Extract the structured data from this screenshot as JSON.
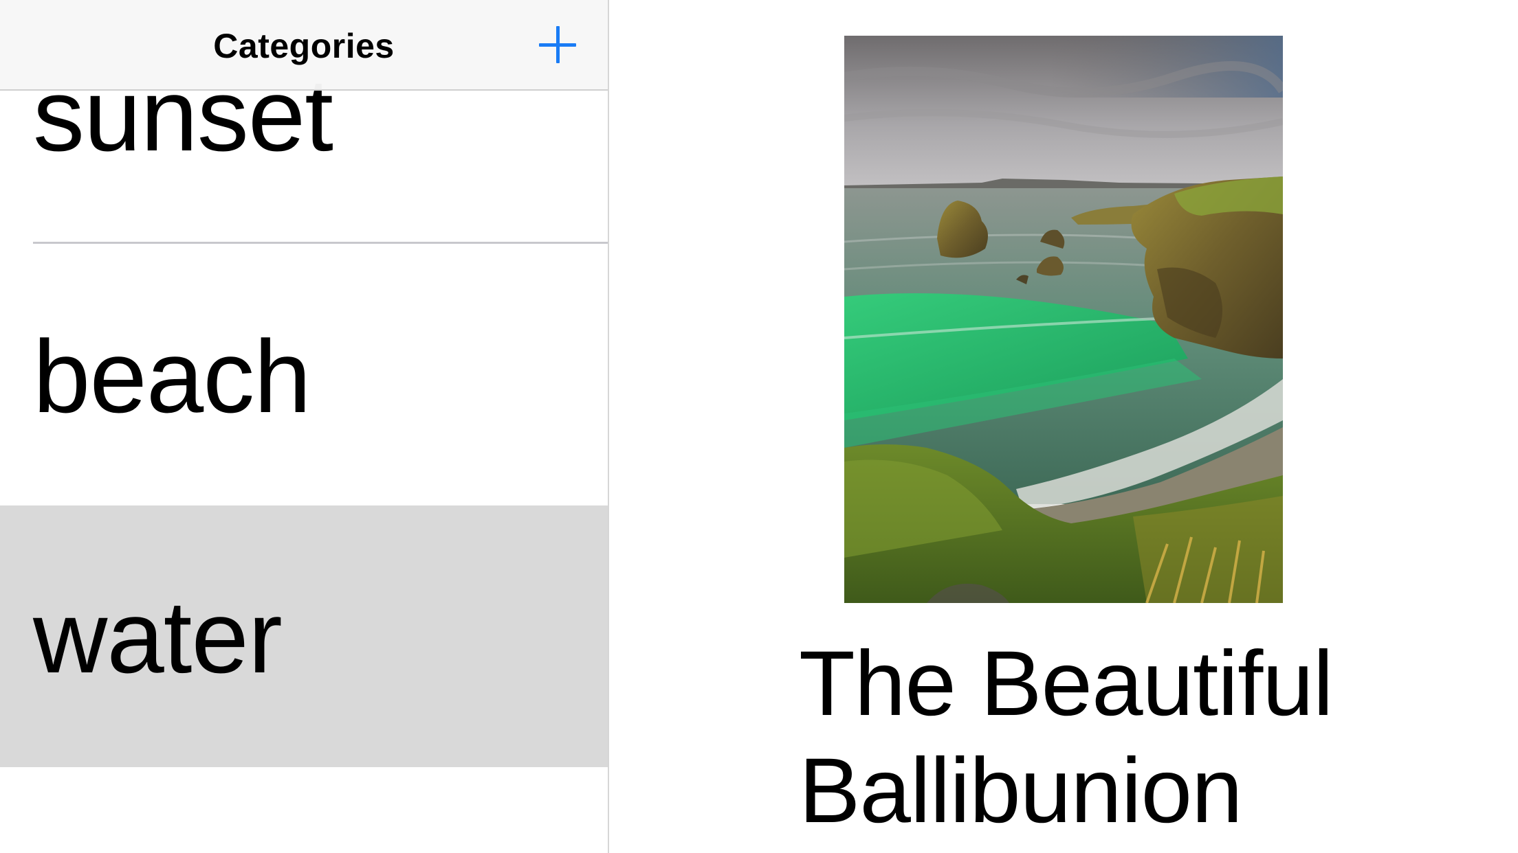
{
  "navbar": {
    "title": "Categories",
    "add_button_icon": "plus-icon",
    "accent_color": "#1a7cf5"
  },
  "categories": [
    {
      "label": "sunset",
      "selected": false
    },
    {
      "label": "beach",
      "selected": false
    },
    {
      "label": "water",
      "selected": true
    }
  ],
  "detail": {
    "image_icon": "coastal-cliff-photo",
    "title": "The Beautiful Ballibunion"
  },
  "colors": {
    "selected_row": "#d9d9d9",
    "separator": "#c8c8cc",
    "navbar_background": "#f7f7f7"
  }
}
